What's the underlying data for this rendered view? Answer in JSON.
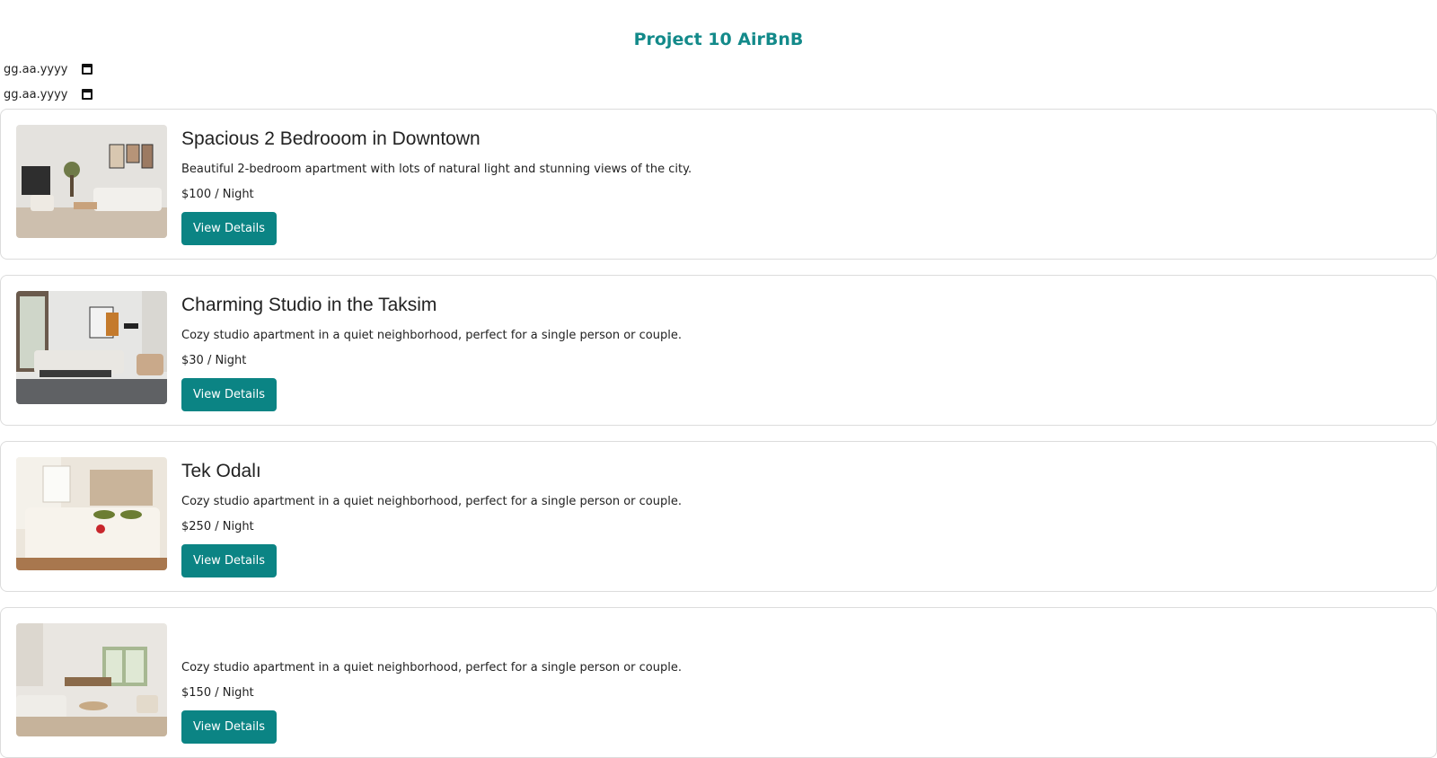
{
  "header": {
    "title": "Project 10 AirBnB"
  },
  "filters": {
    "checkin_placeholder": "gg.aa.yyyy",
    "checkout_placeholder": "gg.aa.yyyy"
  },
  "listings": [
    {
      "title": "Spacious 2 Bedrooom in Downtown",
      "description": "Beautiful 2-bedroom apartment with lots of natural light and stunning views of the city.",
      "price": "$100 / Night",
      "button": "View Details"
    },
    {
      "title": "Charming Studio in the Taksim",
      "description": "Cozy studio apartment in a quiet neighborhood, perfect for a single person or couple.",
      "price": "$30 / Night",
      "button": "View Details"
    },
    {
      "title": "Tek Odalı",
      "description": "Cozy studio apartment in a quiet neighborhood, perfect for a single person or couple.",
      "price": "$250 / Night",
      "button": "View Details"
    },
    {
      "title": "",
      "description": "Cozy studio apartment in a quiet neighborhood, perfect for a single person or couple.",
      "price": "$150 / Night",
      "button": "View Details"
    }
  ],
  "colors": {
    "accent": "#0b8484",
    "title": "#138a8a"
  }
}
